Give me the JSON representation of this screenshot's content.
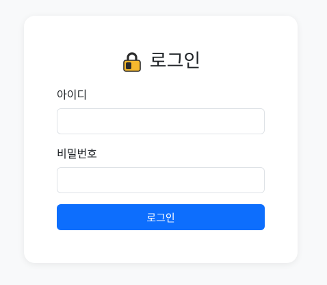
{
  "login": {
    "icon": "locked-padlock-icon",
    "title": "로그인",
    "id_label": "아이디",
    "id_value": "",
    "password_label": "비밀번호",
    "password_value": "",
    "submit_label": "로그인"
  },
  "colors": {
    "page_bg": "#f8f9fa",
    "card_bg": "#ffffff",
    "primary": "#0d6efd",
    "lock_body": "#f5b82e"
  }
}
